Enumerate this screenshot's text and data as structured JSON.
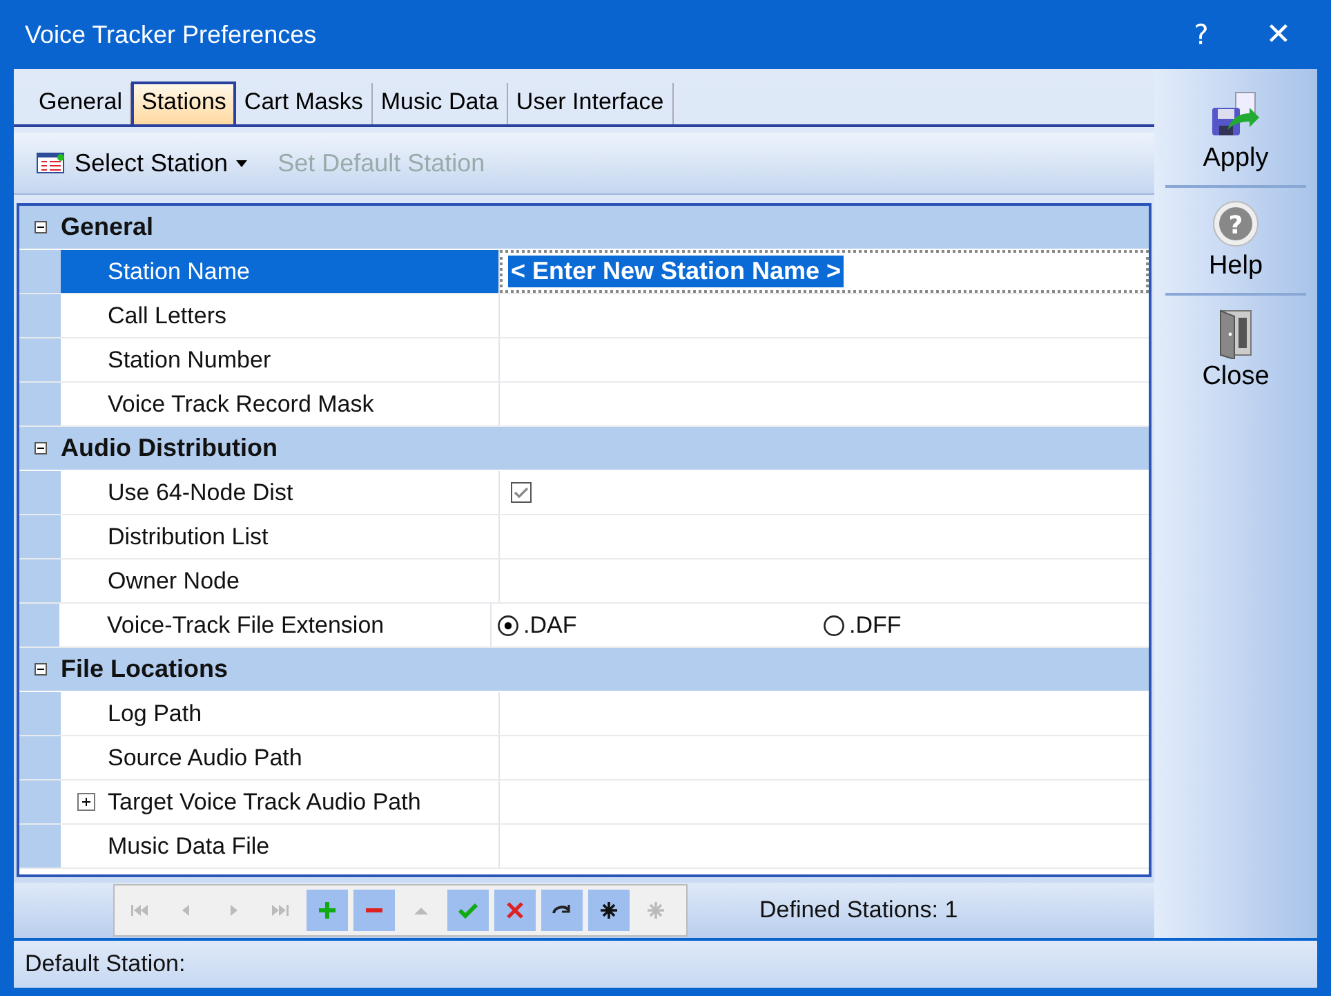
{
  "window": {
    "title": "Voice Tracker Preferences",
    "help_glyph": "?",
    "close_glyph": "✕"
  },
  "tabs": [
    {
      "label": "General",
      "selected": false
    },
    {
      "label": "Stations",
      "selected": true
    },
    {
      "label": "Cart Masks",
      "selected": false
    },
    {
      "label": "Music Data",
      "selected": false
    },
    {
      "label": "User Interface",
      "selected": false
    }
  ],
  "toolbar": [
    {
      "label": "Select Station",
      "kind": "dropdown",
      "disabled": false
    },
    {
      "label": "Set Default Station",
      "kind": "plain",
      "disabled": true
    }
  ],
  "sections": [
    {
      "title": "General",
      "expanded": true,
      "rows": [
        {
          "label": "Station Name",
          "kind": "edit",
          "selected": true,
          "value": "< Enter New Station Name >"
        },
        {
          "label": "Call Letters",
          "kind": "text",
          "selected": false
        },
        {
          "label": "Station Number",
          "kind": "text",
          "selected": false
        },
        {
          "label": "Voice Track Record Mask",
          "kind": "text",
          "selected": false
        }
      ]
    },
    {
      "title": "Audio Distribution",
      "expanded": true,
      "rows": [
        {
          "label": "Use 64-Node Dist",
          "kind": "checkbox",
          "selected": false,
          "checked": true
        },
        {
          "label": "Distribution List",
          "kind": "text",
          "selected": false
        },
        {
          "label": "Owner Node",
          "kind": "text",
          "selected": false
        },
        {
          "label": "Voice-Track File Extension",
          "kind": "radio",
          "selected": false,
          "options": [
            {
              "label": ".DAF",
              "selected": true
            },
            {
              "label": ".DFF",
              "selected": false
            }
          ]
        }
      ]
    },
    {
      "title": "File Locations",
      "expanded": true,
      "rows": [
        {
          "label": "Log Path",
          "kind": "text",
          "selected": false
        },
        {
          "label": "Source Audio Path",
          "kind": "text",
          "selected": false
        },
        {
          "label": "Target Voice Track Audio Path",
          "kind": "text",
          "selected": false,
          "expanded": false
        },
        {
          "label": "Music Data File",
          "kind": "text",
          "selected": false
        }
      ]
    }
  ],
  "navigator": [
    {
      "kind": "first",
      "disabled": true
    },
    {
      "kind": "prev",
      "disabled": true
    },
    {
      "kind": "next",
      "disabled": true
    },
    {
      "kind": "last",
      "disabled": true
    },
    {
      "kind": "add",
      "disabled": false
    },
    {
      "kind": "delete",
      "disabled": false
    },
    {
      "kind": "up",
      "disabled": true
    },
    {
      "kind": "confirm",
      "disabled": false
    },
    {
      "kind": "cancel",
      "disabled": false
    },
    {
      "kind": "redo",
      "disabled": false
    },
    {
      "kind": "asterisk",
      "disabled": false
    },
    {
      "kind": "asterisk",
      "disabled": true
    }
  ],
  "defined_stations": "Defined Stations: 1",
  "side_buttons": [
    {
      "label": "Apply",
      "kind": "apply"
    },
    {
      "label": "Help",
      "kind": "help",
      "glyph": "?"
    },
    {
      "label": "Close",
      "kind": "close"
    }
  ],
  "status_bar": "Default Station:"
}
